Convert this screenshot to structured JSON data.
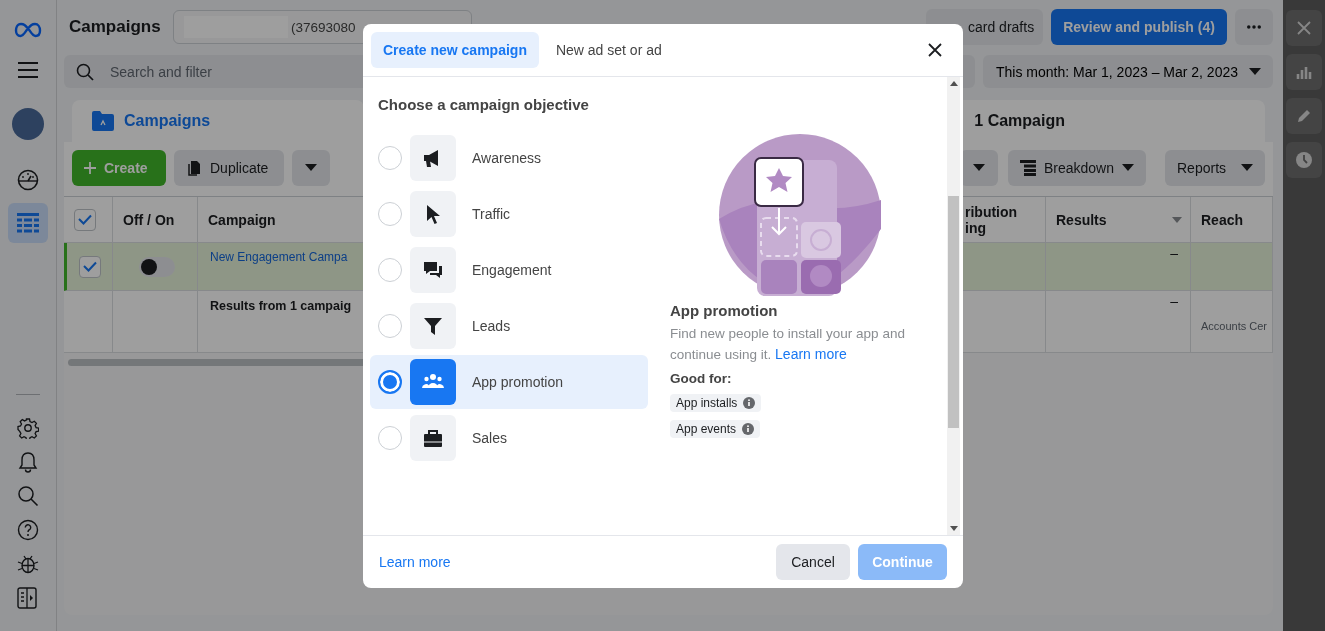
{
  "sidebar": {
    "nav": [
      {
        "kind": "dashboard",
        "selected": false
      },
      {
        "kind": "table",
        "selected": true
      }
    ]
  },
  "header": {
    "title": "Campaigns",
    "account": "(37693080",
    "discard_button": "card drafts",
    "publish_button": "Review and publish (4)"
  },
  "filter": {
    "search": {
      "placeholder": "Search and filter"
    },
    "date_range": "This month: Mar 1, 2023 – Mar 2, 2023"
  },
  "panel": {
    "tabs": [
      {
        "label": "Campaigns",
        "selected": true
      }
    ],
    "heading": "1 Campaign",
    "toolbar": {
      "create": "Create",
      "duplicate": "Duplicate",
      "breakdown": "Breakdown",
      "reports": "Reports"
    },
    "table": {
      "header_checked": true,
      "columns": [
        {
          "kind": "checkbox"
        },
        {
          "kind": "text",
          "label": "Off / On"
        },
        {
          "kind": "text",
          "label": "Campaign"
        },
        {
          "kind": "text",
          "label": "ribution ing"
        },
        {
          "kind": "sort",
          "label": "Results"
        },
        {
          "kind": "text",
          "label": "Reach"
        }
      ],
      "rows": [
        {
          "kind": "campaign",
          "selected": true,
          "checked": true,
          "on": false,
          "campaign": "New Engagement Campa",
          "results": "–"
        },
        {
          "kind": "summary",
          "campaign": "Results from 1 campaig",
          "results": "–",
          "reach": "Accounts Cer"
        }
      ]
    }
  },
  "modal": {
    "tabs": [
      {
        "label": "Create new campaign",
        "selected": true
      },
      {
        "label": "New ad set or ad",
        "selected": false
      }
    ],
    "heading": "Choose a campaign objective",
    "objectives": [
      {
        "kind": "megaphone",
        "label": "Awareness",
        "selected": false
      },
      {
        "kind": "cursor",
        "label": "Traffic",
        "selected": false
      },
      {
        "kind": "chat",
        "label": "Engagement",
        "selected": false
      },
      {
        "kind": "funnel",
        "label": "Leads",
        "selected": false
      },
      {
        "kind": "people",
        "label": "App promotion",
        "selected": true
      },
      {
        "kind": "bag",
        "label": "Sales",
        "selected": false
      }
    ],
    "detail": {
      "title": "App promotion",
      "description": "Find new people to install your app and continue using it.",
      "link": "Learn more",
      "good_for": "Good for:",
      "tags": [
        "App installs",
        "App events"
      ]
    },
    "footer": {
      "link": "Learn more",
      "cancel": "Cancel",
      "continue": {
        "label": "Continue",
        "disabled": true
      }
    }
  }
}
